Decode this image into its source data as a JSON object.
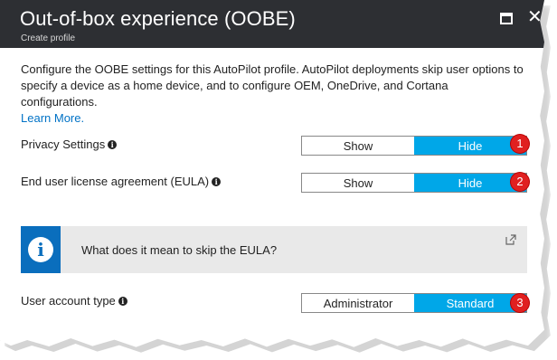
{
  "header": {
    "title": "Out-of-box experience (OOBE)",
    "subtitle": "Create profile",
    "background": "#2d2f33"
  },
  "description": {
    "text": "Configure the OOBE settings for this AutoPilot profile. AutoPilot deployments skip user options to specify a device as a home device, and to configure OEM, OneDrive, and Cortana configurations.",
    "link": "Learn More."
  },
  "settings": [
    {
      "label": "Privacy Settings",
      "options": [
        "Show",
        "Hide"
      ],
      "selected": "Hide",
      "badge": "1"
    },
    {
      "label": "End user license agreement (EULA)",
      "options": [
        "Show",
        "Hide"
      ],
      "selected": "Hide",
      "badge": "2"
    },
    {
      "label": "User account type",
      "options": [
        "Administrator",
        "Standard"
      ],
      "selected": "Standard",
      "badge": "3"
    }
  ],
  "callout": {
    "text": "What does it mean to skip the EULA?"
  },
  "colors": {
    "accent": "#00a7e8",
    "badge": "#e02020",
    "link": "#0072c6",
    "info_blue": "#0a6ebd"
  }
}
